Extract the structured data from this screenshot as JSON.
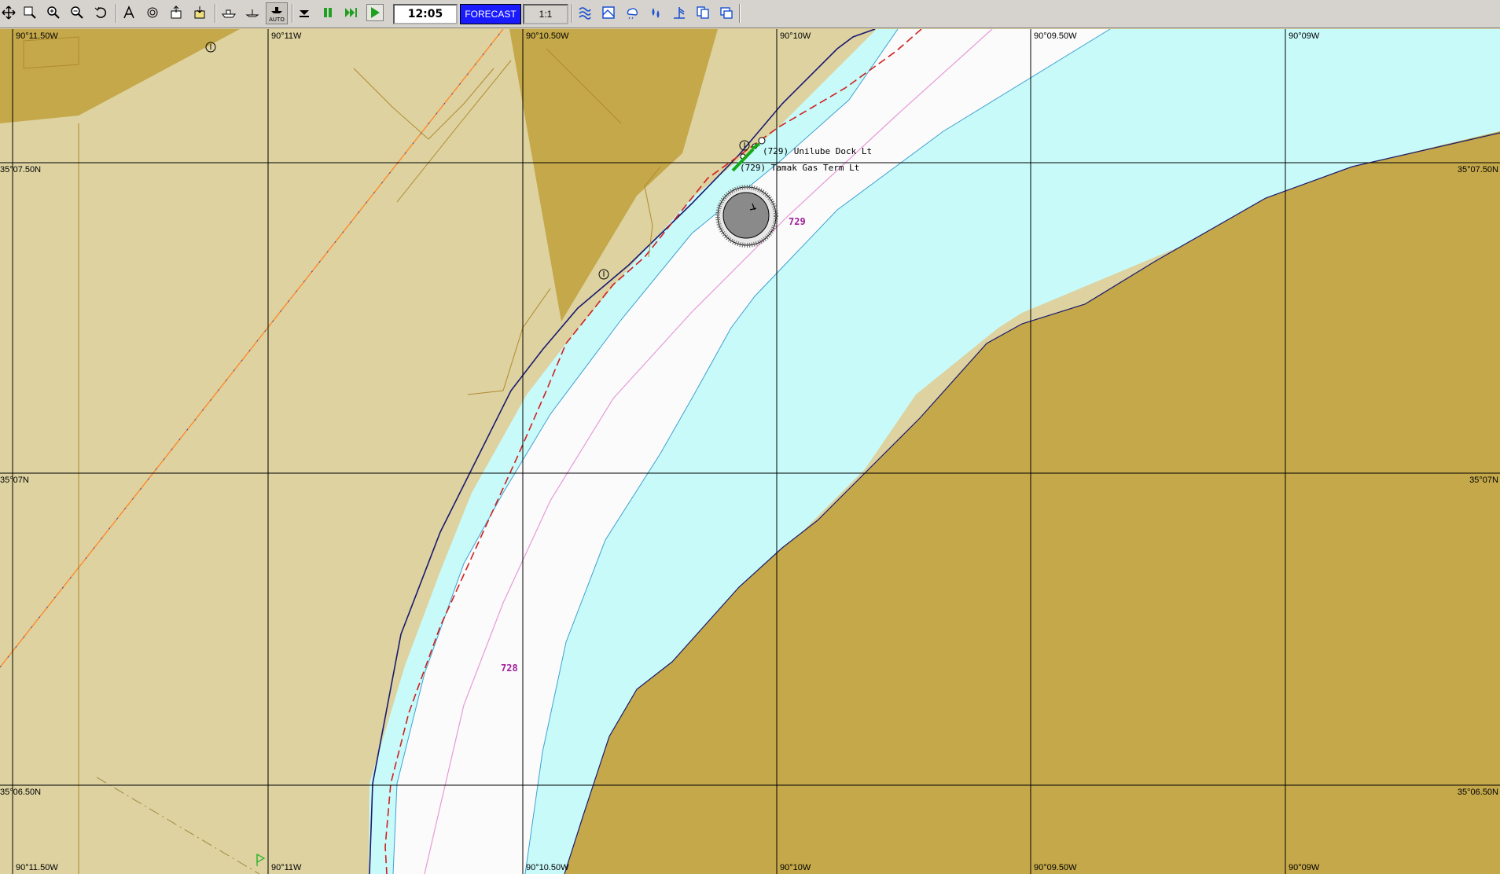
{
  "toolbar": {
    "time": "12:05",
    "forecast_label": "FORECAST",
    "scale": "1:1",
    "auto_label": "AUTO",
    "tools_left": [
      "pan-icon",
      "zoom-box-icon",
      "zoom-in-icon",
      "zoom-out-icon",
      "undo-zoom-icon",
      "route-icon",
      "target-icon",
      "export-icon",
      "import-icon"
    ],
    "tools_vessel": [
      "vessel-icon",
      "ship-mode-icon"
    ],
    "tools_play": [
      "eject-icon",
      "pause-icon",
      "fast-forward-icon",
      "play-icon"
    ],
    "tools_right": [
      "currents-icon",
      "chart-layer-icon",
      "weather-icon",
      "tides-icon",
      "wind-icon",
      "copy-icon",
      "window-icon"
    ]
  },
  "map": {
    "colors": {
      "land_light": "#ddd2a0",
      "land_dark": "#c4a84a",
      "shallow_water": "#c8fafa",
      "deep_water": "#fbfbfb",
      "route": "#d02020",
      "grid": "#000000"
    },
    "lon_top": [
      "90°11.50W",
      "90°11W",
      "90°10.50W",
      "90°10W",
      "90°09.50W",
      "90°09W"
    ],
    "lon_bottom": [
      "90°11.50W",
      "90°11W",
      "90°10.50W",
      "90°10W",
      "90°09.50W",
      "90°09W"
    ],
    "lat_left": [
      "35°07.50N",
      "35°07N",
      "35°06.50N"
    ],
    "lat_right": [
      "35°07.50N",
      "35°07N",
      "35°06.50N"
    ],
    "labels": {
      "unilube": "(729) Unilube Dock Lt",
      "tamak": "(729) Tamak Gas Term Lt",
      "mile_729": "729",
      "mile_728": "728"
    }
  }
}
